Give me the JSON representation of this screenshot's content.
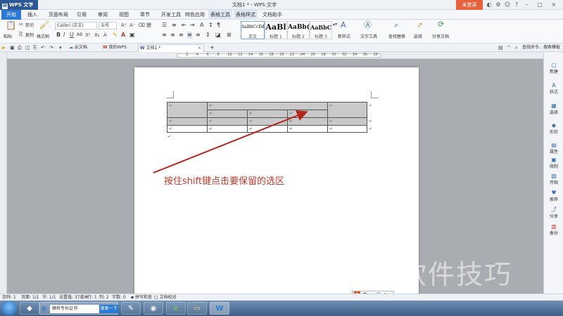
{
  "titlebar": {
    "app_name": "WPS 文字",
    "doc_title": "文档1 * - WPS 文字",
    "login_label": "未登录"
  },
  "menu": {
    "tabs": [
      "开始",
      "插入",
      "页面布局",
      "引用",
      "审阅",
      "视图",
      "章节",
      "开发工具",
      "特色应用",
      "表格工具",
      "表格样式",
      "文档助手"
    ],
    "active": "开始"
  },
  "ribbon": {
    "paste_label": "粘贴",
    "cut_label": "剪切",
    "copy_label": "复制",
    "format_painter_label": "格式刷",
    "font_name": "Calibri (正文)",
    "font_size": "五号",
    "styles": [
      {
        "sample": "AaBbCcDd",
        "name": "正文"
      },
      {
        "sample": "AaBl",
        "name": "标题 1"
      },
      {
        "sample": "AaBb(",
        "name": "标题 2"
      },
      {
        "sample": "AaBbC",
        "name": "标题 3"
      }
    ],
    "new_style_label": "新样式",
    "text_tools_label": "文字工具",
    "find_replace_label": "查找替换",
    "select_label": "选择",
    "share_doc_label": "分享文档"
  },
  "doc_tabs": {
    "cloud_label": "云文档",
    "mywps_label": "我的WPS",
    "active_doc_label": "文档1 *",
    "add_label": "+",
    "command_search_label": "查找命令、搜索模板"
  },
  "ruler": {
    "numbers": [
      "2",
      "4",
      "6",
      "8",
      "10",
      "12",
      "14",
      "16",
      "18",
      "20",
      "22",
      "24",
      "26",
      "28",
      "30",
      "32",
      "34",
      "36",
      "38"
    ]
  },
  "document": {
    "para_mark": "↵",
    "annotation": "按住shift键点击要保留的选区"
  },
  "sidebar": {
    "items": [
      "新建",
      "样式",
      "选择",
      "形状",
      "属性",
      "限制",
      "传图",
      "推荐",
      "分享",
      "备份"
    ]
  },
  "watermark": "软件技巧",
  "statusbar": {
    "page": "页码: 1",
    "pages": "页面: 1/1",
    "section": "节: 1/1",
    "setting": "设置值: 37毫米",
    "row": "行: 1",
    "col": "列: 2",
    "chars": "字数: 0",
    "spell": "拼写检查",
    "proof": "文档校对"
  },
  "taskbar": {
    "browser_text": "确有专长证书",
    "search_btn": "搜索一下"
  },
  "tray": {
    "ime_label": "中"
  }
}
